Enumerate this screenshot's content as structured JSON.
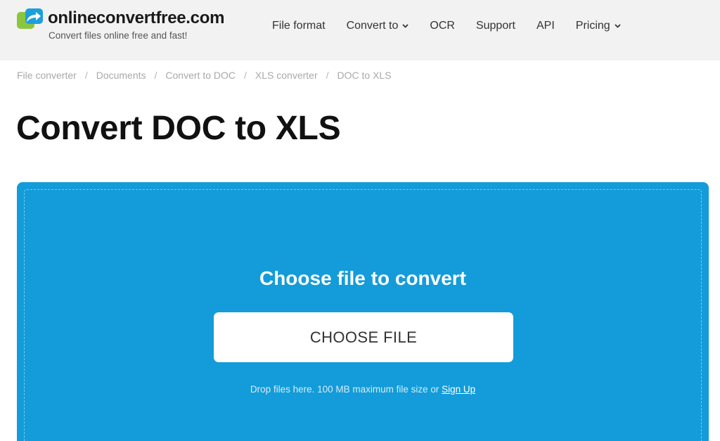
{
  "header": {
    "logo_name": "onlineconvertfree.com",
    "logo_tagline": "Convert files online free and fast!",
    "nav": {
      "file_format": "File format",
      "convert_to": "Convert to",
      "ocr": "OCR",
      "support": "Support",
      "api": "API",
      "pricing": "Pricing"
    }
  },
  "breadcrumb": [
    "File converter",
    "Documents",
    "Convert to DOC",
    "XLS converter",
    "DOC to XLS"
  ],
  "breadcrumb_separator": "/",
  "page": {
    "title": "Convert DOC to XLS"
  },
  "dropzone": {
    "title": "Choose file to convert",
    "button_label": "CHOOSE FILE",
    "note_text": "Drop files here. 100 MB maximum file size or ",
    "signup_link": "Sign Up"
  },
  "colors": {
    "header_bg": "#f2f2f2",
    "dropzone_bg": "#139cd9",
    "logo_green": "#8cc63f",
    "logo_blue": "#1d9fdc"
  }
}
